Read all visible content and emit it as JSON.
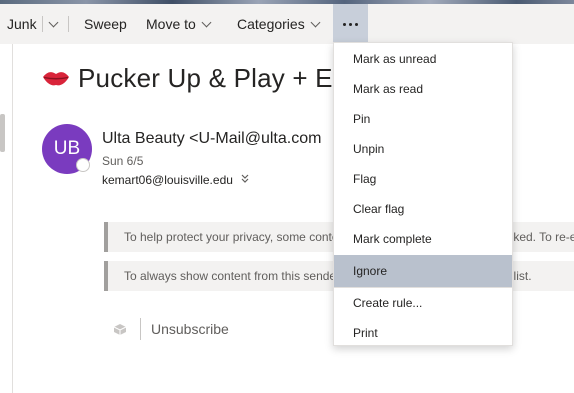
{
  "toolbar": {
    "junk_label": "Junk",
    "sweep_label": "Sweep",
    "move_to_label": "Move to",
    "categories_label": "Categories",
    "more_label": "•••"
  },
  "message": {
    "subject": "Pucker Up & Play + Ea",
    "avatar_initials": "UB",
    "sender": "Ulta Beauty <U-Mail@ulta.com",
    "date": "Sun 6/5",
    "recipient": "kemart06@louisville.edu",
    "privacy_notice": "To help protect your privacy, some content in this message has been blocked. To re-en",
    "sender_notice": "To always show content from this sender, add them to your Safe senders list.",
    "unsubscribe_label": "Unsubscribe"
  },
  "menu": {
    "items": [
      "Mark as unread",
      "Mark as read",
      "Pin",
      "Unpin",
      "Flag",
      "Clear flag",
      "Mark complete",
      "Ignore",
      "Create rule...",
      "Print"
    ],
    "selected": "Ignore"
  },
  "icons": {
    "subject_emoji": "lips-icon",
    "recipient_expand": "double-chevron-down-icon",
    "unsubscribe": "unsubscribe-icon"
  },
  "colors": {
    "toolbar_bg": "#f3f2f1",
    "more_button_active": "#c8cfda",
    "avatar_bg": "#7a3bbf",
    "menu_selected": "#b9c1cd",
    "lips": "#d9243a"
  }
}
